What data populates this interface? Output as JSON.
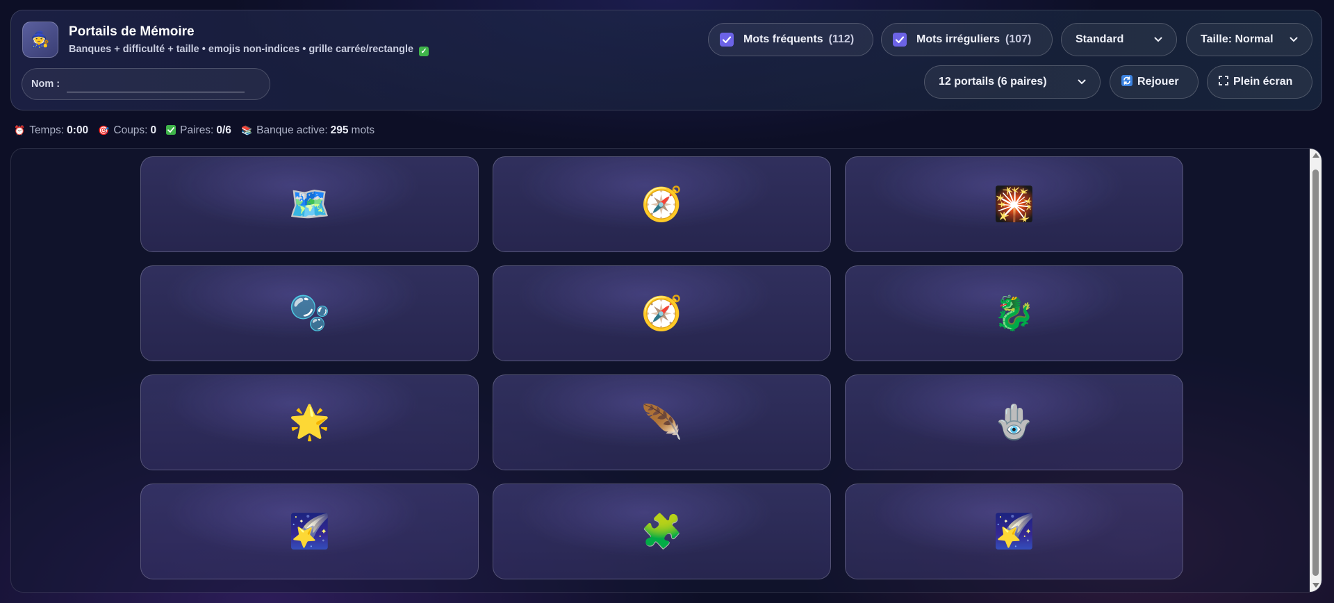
{
  "header": {
    "logo_icon": "wizard-portal-icon",
    "logo_glyph": "🧙",
    "title": "Portails de Mémoire",
    "subtitle": "Banques + difficulté + taille • emojis non-indices • grille carrée/rectangle",
    "subtitle_badge": "✓",
    "name_label": "Nom :",
    "name_value": "",
    "name_placeholder": ""
  },
  "controls": {
    "frequent": {
      "label": "Mots fréquents",
      "count": "(112)",
      "checked": true
    },
    "irregular": {
      "label": "Mots irréguliers",
      "count": "(107)",
      "checked": true
    },
    "difficulty": {
      "selected": "Standard"
    },
    "size": {
      "selected": "Taille: Normal"
    },
    "portals": {
      "selected": "12 portails (6 paires)"
    },
    "replay": {
      "label": "Rejouer",
      "icon": "replay-icon"
    },
    "fullscreen": {
      "label": "Plein écran",
      "icon": "fullscreen-icon"
    }
  },
  "stats": {
    "time_label": "Temps:",
    "time_value": "0:00",
    "moves_label": "Coups:",
    "moves_value": "0",
    "pairs_label": "Paires:",
    "pairs_value": "0/6",
    "bank_label": "Banque active:",
    "bank_value": "295",
    "bank_unit": "mots"
  },
  "cards": [
    {
      "emoji": "🗺️",
      "icon": "world-map-icon"
    },
    {
      "emoji": "🧭",
      "icon": "compass-icon"
    },
    {
      "emoji": "🎇",
      "icon": "sparkler-icon"
    },
    {
      "emoji": "🫧",
      "icon": "crystal-orb-icon"
    },
    {
      "emoji": "🧭",
      "icon": "compass-icon"
    },
    {
      "emoji": "🐉",
      "icon": "dragon-icon"
    },
    {
      "emoji": "🌟",
      "icon": "glowing-star-icon"
    },
    {
      "emoji": "🪶",
      "icon": "feather-icon"
    },
    {
      "emoji": "🪬",
      "icon": "hamsa-icon"
    },
    {
      "emoji": "🌠",
      "icon": "shooting-star-icon"
    },
    {
      "emoji": "🧩",
      "icon": "puzzle-piece-icon"
    },
    {
      "emoji": "🌠",
      "icon": "shooting-star-icon"
    }
  ],
  "colors": {
    "accent": "#6c63e6",
    "success": "#3fb44a",
    "background": "#0d0f26"
  }
}
